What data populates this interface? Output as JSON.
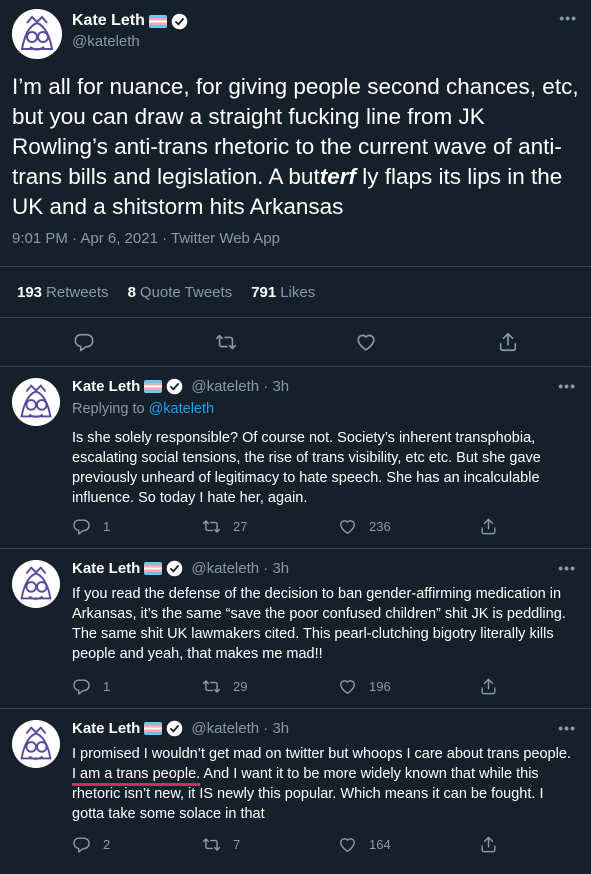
{
  "main": {
    "name": "Kate Leth",
    "handle": "@kateleth",
    "text_part1": "I’m all for nuance, for giving people second chances, etc, but you can draw a straight fucking line from JK Rowling’s anti-trans rhetoric to the current wave of anti-trans bills and legislation. A but",
    "text_styled": "terf",
    "text_part2": " ly flaps its lips in the UK and a shitstorm hits Arkansas",
    "timestamp": "9:01 PM · Apr 6, 2021 · Twitter Web App",
    "stats": {
      "retweets_count": "193",
      "retweets_label": "Retweets",
      "quotes_count": "8",
      "quotes_label": "Quote Tweets",
      "likes_count": "791",
      "likes_label": "Likes"
    }
  },
  "replies": [
    {
      "name": "Kate Leth",
      "handle": "@kateleth · 3h",
      "replying_prefix": "Replying to ",
      "replying_handle": "@kateleth",
      "text": "Is she solely responsible? Of course not. Society’s inherent transphobia, escalating social tensions, the rise of trans visibility, etc etc. But she gave previously unheard of legitimacy to hate speech. She has an incalculable influence. So today I hate her, again.",
      "replies": "1",
      "retweets": "27",
      "likes": "236"
    },
    {
      "name": "Kate Leth",
      "handle": "@kateleth · 3h",
      "text": "If you read the defense of the decision to ban gender-affirming medication in Arkansas, it’s the same “save the poor confused children” shit JK is peddling. The same shit UK lawmakers cited. This pearl-clutching bigotry literally kills people and yeah, that makes me mad!!",
      "replies": "1",
      "retweets": "29",
      "likes": "196"
    },
    {
      "name": "Kate Leth",
      "handle": "@kateleth · 3h",
      "text_part1": "I promised I wouldn’t get mad on twitter but whoops I care about trans people. ",
      "text_underlined": "I am a trans people.",
      "text_part2": " And I want it to be more widely known that while this rhetoric isn’t new, it IS newly this popular. Which means it can be fought. I gotta take some solace in that",
      "replies": "2",
      "retweets": "7",
      "likes": "164"
    }
  ],
  "icons": {
    "more": "more-icon",
    "reply": "reply-icon",
    "retweet": "retweet-icon",
    "like": "heart-icon",
    "share": "share-icon",
    "verified": "verified-badge-icon",
    "flag": "trans-flag-icon"
  },
  "colors": {
    "background": "#15202b",
    "secondary_text": "#8899a6",
    "link": "#1da1f2",
    "divider": "#38444d",
    "underline": "#e0245e"
  }
}
